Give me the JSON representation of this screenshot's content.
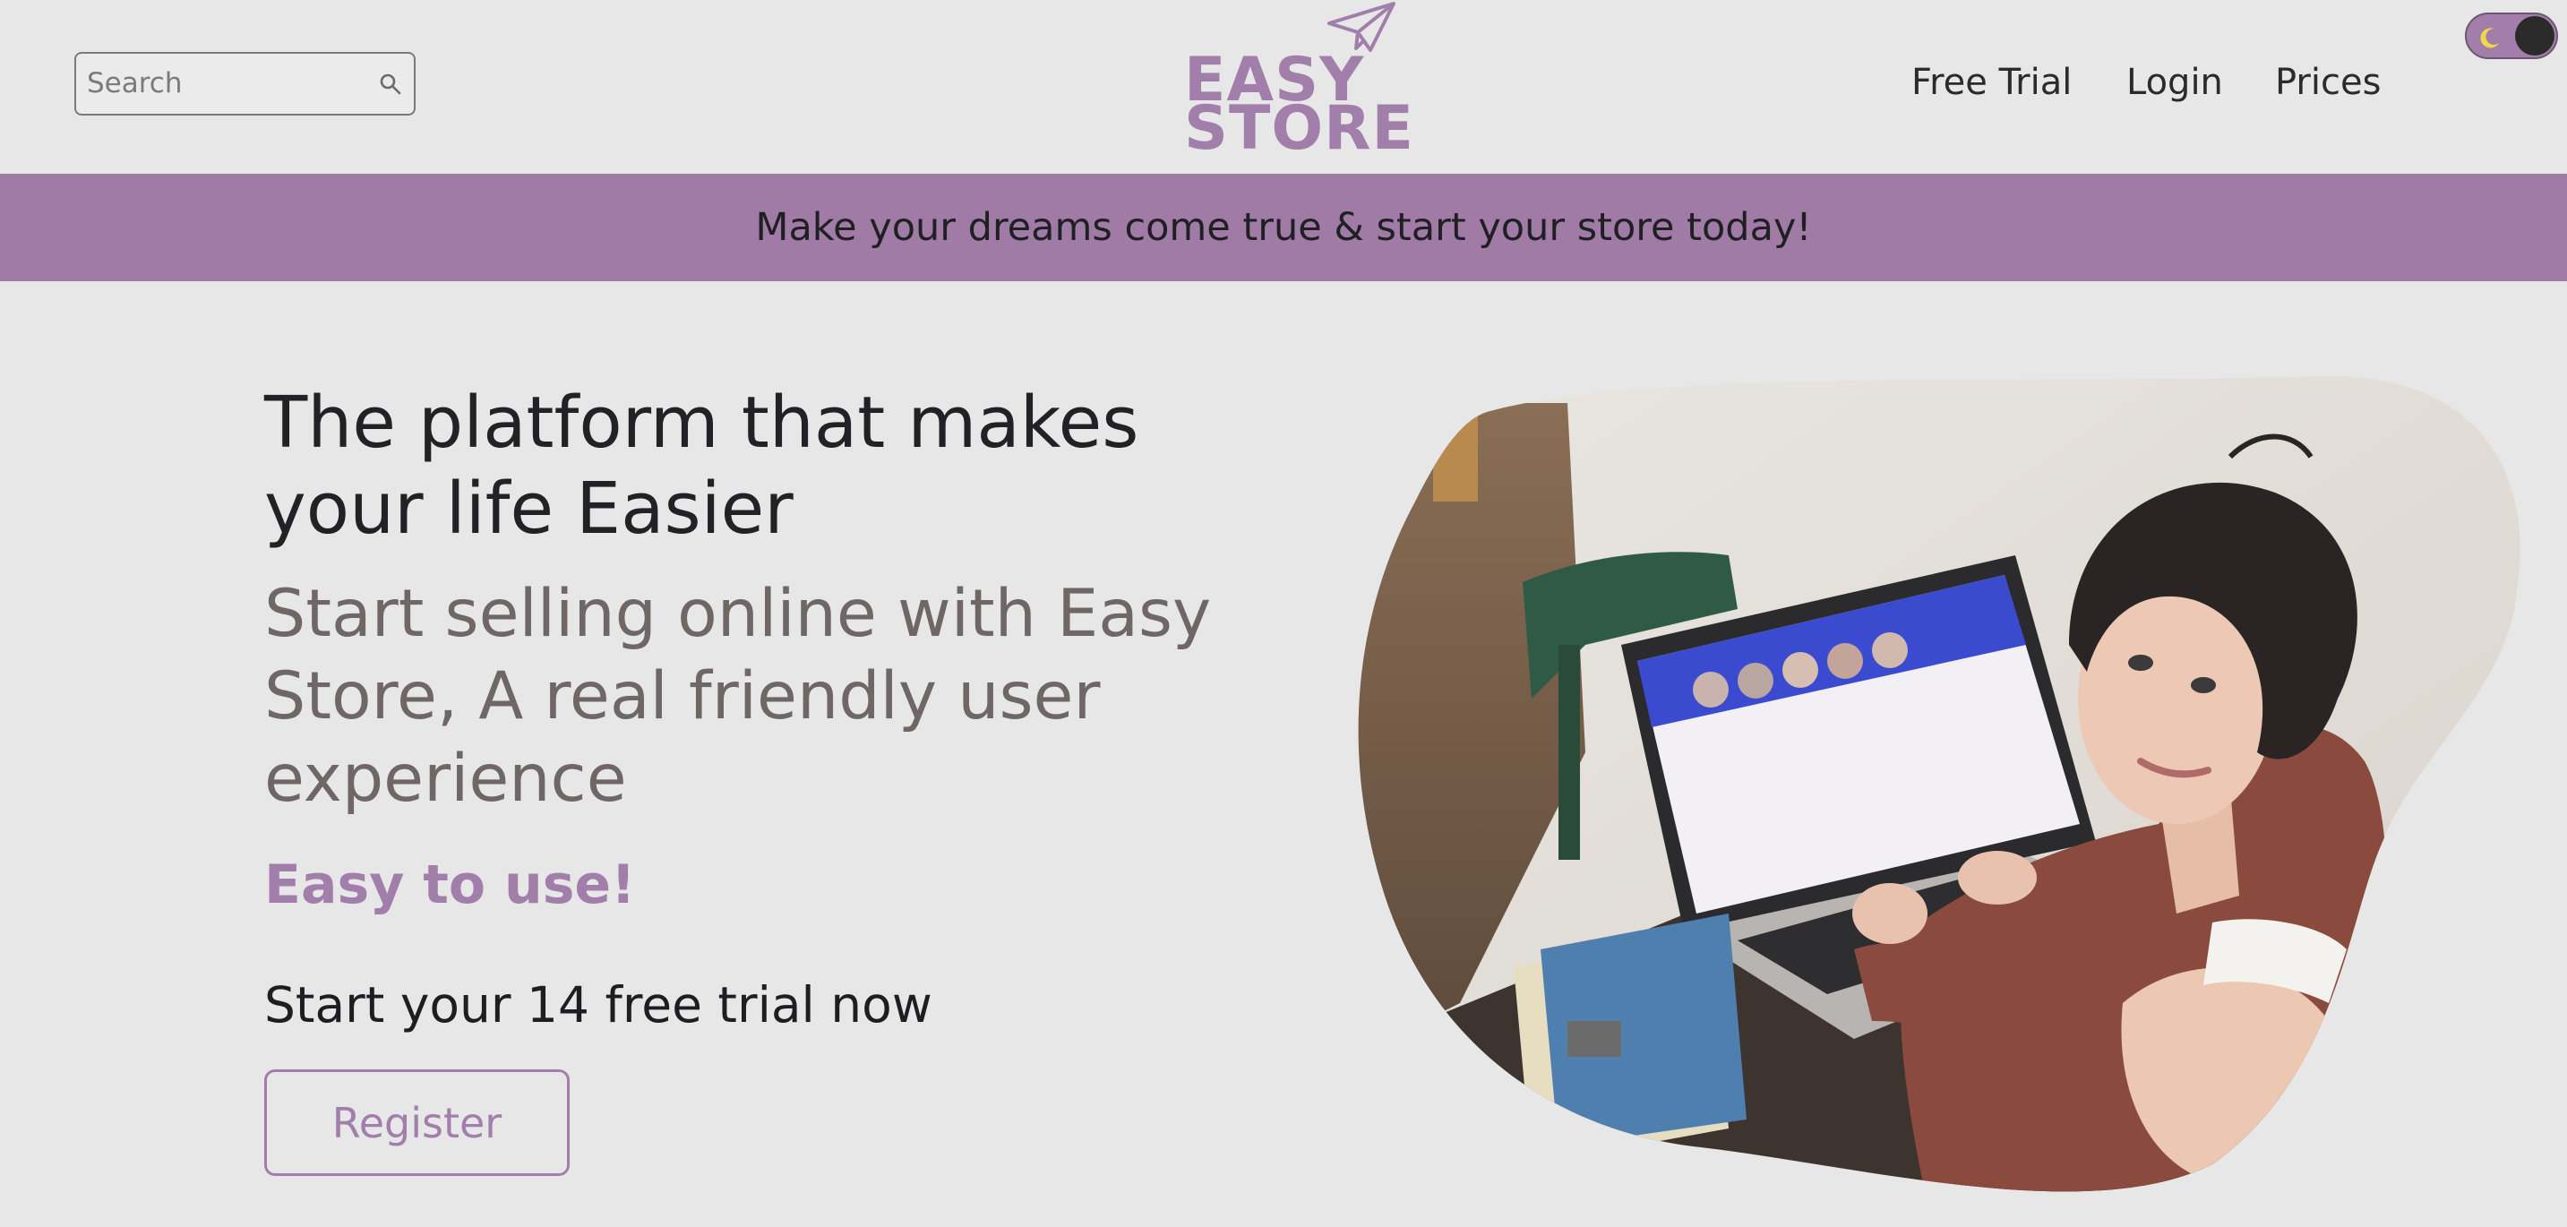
{
  "header": {
    "search": {
      "placeholder": "Search",
      "value": "",
      "icon": "search-icon"
    },
    "logo": {
      "line1": "EASY",
      "line2": "STORE",
      "icon": "paper-plane-icon"
    },
    "nav": {
      "free_trial": "Free Trial",
      "login": "Login",
      "prices": "Prices"
    },
    "theme_toggle": {
      "icon": "moon-icon",
      "state": "dark"
    }
  },
  "banner": {
    "text": "Make your dreams come true & start your store today!"
  },
  "hero": {
    "title": "The platform that makes your life Easier",
    "subtitle": "Start selling online with Easy Store, A real friendly user experience",
    "tagline": "Easy to use!",
    "cta_text": "Start your 14 free trial now",
    "register_label": "Register"
  },
  "colors": {
    "accent": "#a27fab",
    "banner": "#a07ba5",
    "background": "#e8e7e8",
    "text_dark": "#222226",
    "text_muted": "#6f6666"
  }
}
